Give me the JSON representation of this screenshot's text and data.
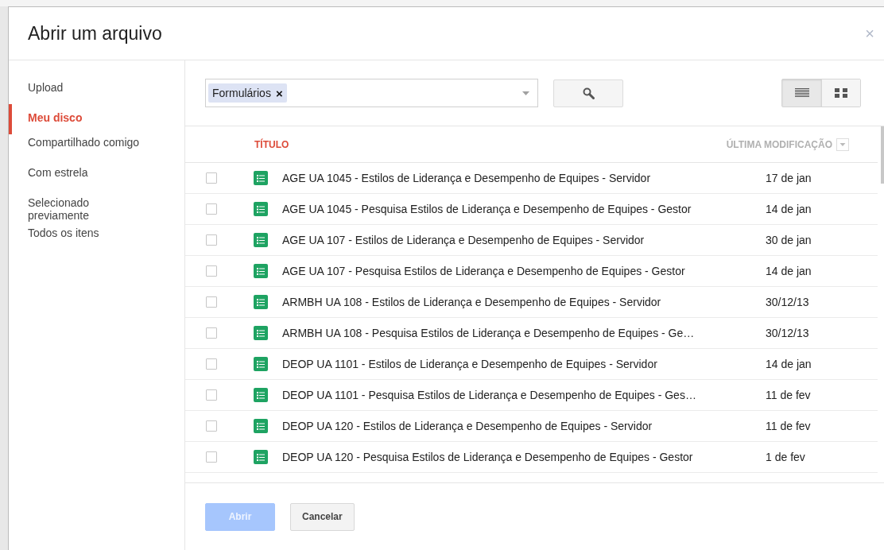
{
  "dialog": {
    "title": "Abrir um arquivo",
    "close": "×"
  },
  "sidebar": {
    "items": [
      {
        "label": "Upload",
        "selected": false
      },
      {
        "label": "Meu disco",
        "selected": true
      },
      {
        "label": "Compartilhado comigo",
        "selected": false
      },
      {
        "label": "Com estrela",
        "selected": false
      },
      {
        "label": "Selecionado previamente",
        "selected": false
      },
      {
        "label": "Todos os itens",
        "selected": false
      }
    ]
  },
  "search": {
    "chip": "Formulários",
    "chip_remove": "×"
  },
  "view_toggle": [
    {
      "kind": "list",
      "selected": true
    },
    {
      "kind": "grid",
      "selected": false
    }
  ],
  "table": {
    "columns": [
      "TÍTULO",
      "ÚLTIMA MODIFICAÇÃO"
    ],
    "rows": [
      {
        "title": "AGE UA 1045 - Estilos de Liderança e Desempenho de Equipes - Servidor",
        "date": "17 de jan",
        "checked": false
      },
      {
        "title": "AGE UA 1045 - Pesquisa Estilos de Liderança e Desempenho de Equipes - Gestor",
        "date": "14 de jan",
        "checked": false
      },
      {
        "title": "AGE UA 107 - Estilos de Liderança e Desempenho de Equipes - Servidor",
        "date": "30 de jan",
        "checked": false
      },
      {
        "title": "AGE UA 107 - Pesquisa Estilos de Liderança e Desempenho de Equipes - Gestor",
        "date": "14 de jan",
        "checked": false
      },
      {
        "title": "ARMBH UA 108 - Estilos de Liderança e Desempenho de Equipes - Servidor",
        "date": "30/12/13",
        "checked": false
      },
      {
        "title": "ARMBH UA 108 - Pesquisa Estilos de Liderança e Desempenho de Equipes - Ge…",
        "date": "30/12/13",
        "checked": false
      },
      {
        "title": "DEOP UA 1101 - Estilos de Liderança e Desempenho de Equipes - Servidor",
        "date": "14 de jan",
        "checked": false
      },
      {
        "title": "DEOP UA 1101 - Pesquisa Estilos de Liderança e Desempenho de Equipes - Ges…",
        "date": "11 de fev",
        "checked": false
      },
      {
        "title": "DEOP UA 120 - Estilos de Liderança e Desempenho de Equipes - Servidor",
        "date": "11 de fev",
        "checked": false
      },
      {
        "title": "DEOP UA 120 - Pesquisa Estilos de Liderança e Desempenho de Equipes - Gestor",
        "date": "1 de fev",
        "checked": false
      }
    ]
  },
  "buttons": [
    {
      "label": "Abrir",
      "disabled": true
    },
    {
      "label": "Cancelar",
      "disabled": false
    }
  ]
}
